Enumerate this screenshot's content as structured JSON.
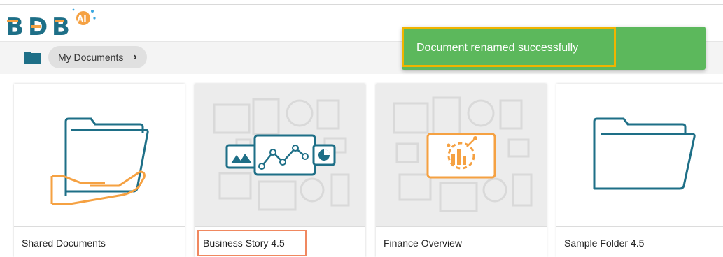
{
  "brand": {
    "logo_text": "BDB",
    "logo_badge": "AI"
  },
  "breadcrumb": {
    "label": "My Documents",
    "chevron": "›"
  },
  "toast": {
    "message": "Document renamed successfully"
  },
  "documents": [
    {
      "title": "Shared Documents",
      "icon": "shared-folder-icon"
    },
    {
      "title": "Business Story 4.5",
      "icon": "business-story-icon"
    },
    {
      "title": "Finance Overview",
      "icon": "dashboard-icon"
    },
    {
      "title": "Sample Folder 4.5",
      "icon": "folder-icon"
    }
  ],
  "colors": {
    "accent_teal": "#1e6f87",
    "accent_orange": "#f5a142",
    "toast_green": "#5cb85c",
    "toast_highlight": "#f0b400",
    "selection_highlight": "#f08860"
  }
}
